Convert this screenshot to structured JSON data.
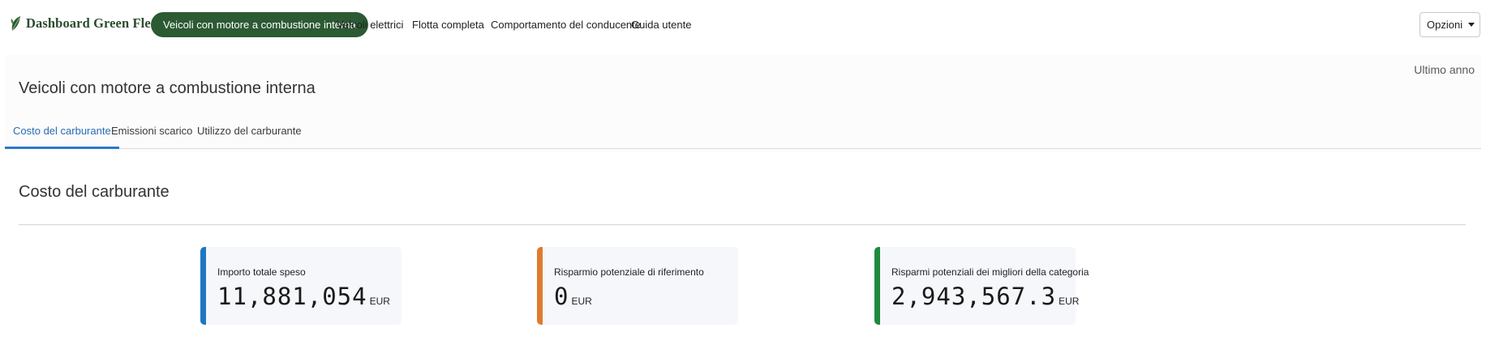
{
  "nav": {
    "brand": "Dashboard Green Fleet",
    "items": [
      "Veicoli con motore a combustione interna",
      "Veicoli elettrici",
      "Flotta completa",
      "Comportamento del conducente",
      "Guida utente"
    ],
    "active_index": 0,
    "options_label": "Opzioni"
  },
  "page": {
    "period": "Ultimo anno",
    "title": "Veicoli con motore a combustione interna",
    "tabs": [
      "Costo del carburante",
      "Emissioni scarico",
      "Utilizzo del carburante"
    ],
    "active_tab": 0
  },
  "section": {
    "title": "Costo del carburante",
    "cards": [
      {
        "label": "Importo totale speso",
        "value": "11,881,054",
        "unit": "EUR",
        "accent": "#1f77c4"
      },
      {
        "label": "Risparmio potenziale di riferimento",
        "value": "0",
        "unit": "EUR",
        "accent": "#e07b2e"
      },
      {
        "label": "Risparmi potenziali dei migliori della categoria",
        "value": "2,943,567.3",
        "unit": "EUR",
        "accent": "#1e8a3e"
      }
    ]
  },
  "colors": {
    "brand_green": "#2b5a33",
    "tab_active_blue": "#2a78c8"
  },
  "icons": {
    "brand": "leaf-icon",
    "options_caret": "chevron-down-icon"
  }
}
